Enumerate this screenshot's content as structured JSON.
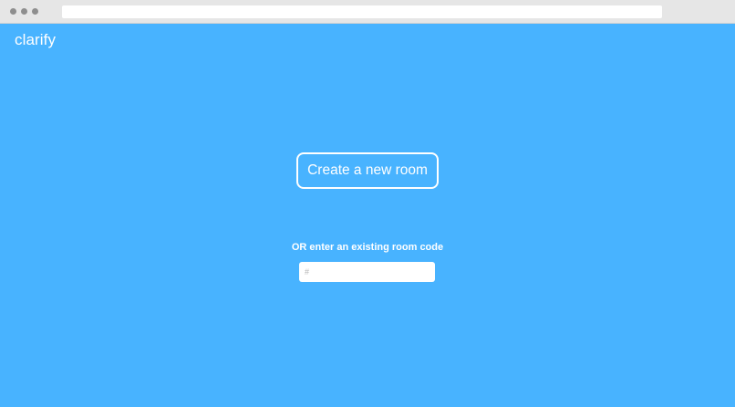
{
  "app": {
    "brand": "clarify"
  },
  "main": {
    "create_button_label": "Create a new room",
    "join_prompt": "OR enter an existing room code",
    "room_code_input": {
      "value": "",
      "placeholder": "#"
    }
  },
  "colors": {
    "page_background": "#48b3ff",
    "foreground": "#ffffff",
    "input_background": "#ffffff"
  }
}
